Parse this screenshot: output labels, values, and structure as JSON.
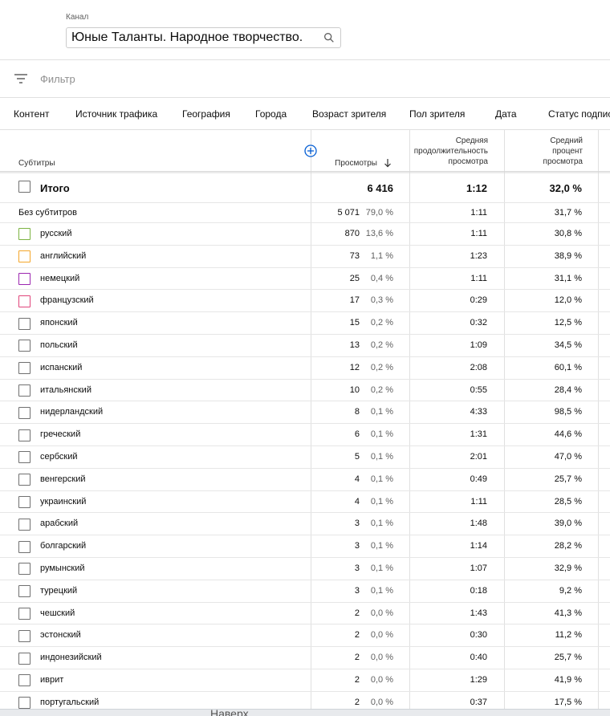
{
  "channel": {
    "label": "Канал",
    "value": "Юные Таланты. Народное творчество."
  },
  "filter": {
    "placeholder": "Фильтр"
  },
  "tabs": [
    "Контент",
    "Источник трафика",
    "География",
    "Города",
    "Возраст зрителя",
    "Пол зрителя",
    "Дата",
    "Статус подпис"
  ],
  "table": {
    "headers": {
      "dimension": "Субтитры",
      "views": "Просмотры",
      "avg_duration": [
        "Средняя",
        "продолжительность",
        "просмотра"
      ],
      "avg_percent": [
        "Средний",
        "процент",
        "просмотра"
      ]
    },
    "total": {
      "label": "Итого",
      "views": "6 416",
      "avg_duration": "1:12",
      "avg_percent": "32,0 %"
    },
    "rows": [
      {
        "name": "Без субтитров",
        "views": "5 071",
        "share": "79,0 %",
        "dur": "1:11",
        "pct": "31,7 %",
        "checkbox": false,
        "color": ""
      },
      {
        "name": "русский",
        "views": "870",
        "share": "13,6 %",
        "dur": "1:11",
        "pct": "30,8 %",
        "checkbox": true,
        "color": "#7cb342"
      },
      {
        "name": "английский",
        "views": "73",
        "share": "1,1 %",
        "dur": "1:23",
        "pct": "38,9 %",
        "checkbox": true,
        "color": "#f4a62a"
      },
      {
        "name": "немецкий",
        "views": "25",
        "share": "0,4 %",
        "dur": "1:11",
        "pct": "31,1 %",
        "checkbox": true,
        "color": "#9c27b0"
      },
      {
        "name": "французский",
        "views": "17",
        "share": "0,3 %",
        "dur": "0:29",
        "pct": "12,0 %",
        "checkbox": true,
        "color": "#e0457b"
      },
      {
        "name": "японский",
        "views": "15",
        "share": "0,2 %",
        "dur": "0:32",
        "pct": "12,5 %",
        "checkbox": true,
        "color": ""
      },
      {
        "name": "польский",
        "views": "13",
        "share": "0,2 %",
        "dur": "1:09",
        "pct": "34,5 %",
        "checkbox": true,
        "color": ""
      },
      {
        "name": "испанский",
        "views": "12",
        "share": "0,2 %",
        "dur": "2:08",
        "pct": "60,1 %",
        "checkbox": true,
        "color": ""
      },
      {
        "name": "итальянский",
        "views": "10",
        "share": "0,2 %",
        "dur": "0:55",
        "pct": "28,4 %",
        "checkbox": true,
        "color": ""
      },
      {
        "name": "нидерландский",
        "views": "8",
        "share": "0,1 %",
        "dur": "4:33",
        "pct": "98,5 %",
        "checkbox": true,
        "color": ""
      },
      {
        "name": "греческий",
        "views": "6",
        "share": "0,1 %",
        "dur": "1:31",
        "pct": "44,6 %",
        "checkbox": true,
        "color": ""
      },
      {
        "name": "сербский",
        "views": "5",
        "share": "0,1 %",
        "dur": "2:01",
        "pct": "47,0 %",
        "checkbox": true,
        "color": ""
      },
      {
        "name": "венгерский",
        "views": "4",
        "share": "0,1 %",
        "dur": "0:49",
        "pct": "25,7 %",
        "checkbox": true,
        "color": ""
      },
      {
        "name": "украинский",
        "views": "4",
        "share": "0,1 %",
        "dur": "1:11",
        "pct": "28,5 %",
        "checkbox": true,
        "color": ""
      },
      {
        "name": "арабский",
        "views": "3",
        "share": "0,1 %",
        "dur": "1:48",
        "pct": "39,0 %",
        "checkbox": true,
        "color": ""
      },
      {
        "name": "болгарский",
        "views": "3",
        "share": "0,1 %",
        "dur": "1:14",
        "pct": "28,2 %",
        "checkbox": true,
        "color": ""
      },
      {
        "name": "румынский",
        "views": "3",
        "share": "0,1 %",
        "dur": "1:07",
        "pct": "32,9 %",
        "checkbox": true,
        "color": ""
      },
      {
        "name": "турецкий",
        "views": "3",
        "share": "0,1 %",
        "dur": "0:18",
        "pct": "9,2 %",
        "checkbox": true,
        "color": ""
      },
      {
        "name": "чешский",
        "views": "2",
        "share": "0,0 %",
        "dur": "1:43",
        "pct": "41,3 %",
        "checkbox": true,
        "color": ""
      },
      {
        "name": "эстонский",
        "views": "2",
        "share": "0,0 %",
        "dur": "0:30",
        "pct": "11,2 %",
        "checkbox": true,
        "color": ""
      },
      {
        "name": "индонезийский",
        "views": "2",
        "share": "0,0 %",
        "dur": "0:40",
        "pct": "25,7 %",
        "checkbox": true,
        "color": ""
      },
      {
        "name": "иврит",
        "views": "2",
        "share": "0,0 %",
        "dur": "1:29",
        "pct": "41,9 %",
        "checkbox": true,
        "color": ""
      },
      {
        "name": "португальский",
        "views": "2",
        "share": "0,0 %",
        "dur": "0:37",
        "pct": "17,5 %",
        "checkbox": true,
        "color": ""
      }
    ]
  },
  "bottom_bar": {
    "text": "Наверх"
  },
  "icons": {
    "search": "search-icon",
    "filter": "filter-icon",
    "add_column": "add-circle-icon",
    "sort": "arrow-down-icon"
  },
  "colors": {
    "accent": "#065fd4"
  }
}
